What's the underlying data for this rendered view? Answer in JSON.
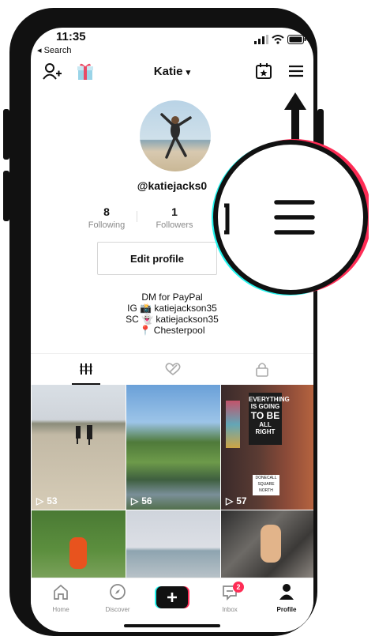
{
  "status": {
    "time": "11:35",
    "back_label": "◂ Search"
  },
  "header": {
    "account_name": "Katie",
    "chevron": "chevron-down-icon"
  },
  "profile": {
    "username": "@katiejacks0",
    "following_count": "8",
    "following_label": "Following",
    "followers_count": "1",
    "followers_label": "Followers",
    "edit_label": "Edit profile",
    "bio": [
      "DM for PayPal",
      "IG 📸 katiejackson35",
      "SC 👻 katiejackson35",
      "📍 Chesterpool"
    ]
  },
  "videos": [
    {
      "plays": "53"
    },
    {
      "plays": "56"
    },
    {
      "plays": "57"
    },
    {
      "plays": ""
    },
    {
      "plays": ""
    },
    {
      "plays": ""
    }
  ],
  "sign_text": [
    "EVERYTHING",
    "IS GOING",
    "TO BE",
    "ALL RIGHT"
  ],
  "street_sign": [
    "DONECALL",
    "SQUARE",
    "NORTH"
  ],
  "nav": {
    "home": "Home",
    "discover": "Discover",
    "inbox": "Inbox",
    "inbox_badge": "2",
    "profile": "Profile"
  },
  "colors": {
    "accent_red": "#fe2c55",
    "accent_cyan": "#25f4ee",
    "text": "#111111"
  }
}
